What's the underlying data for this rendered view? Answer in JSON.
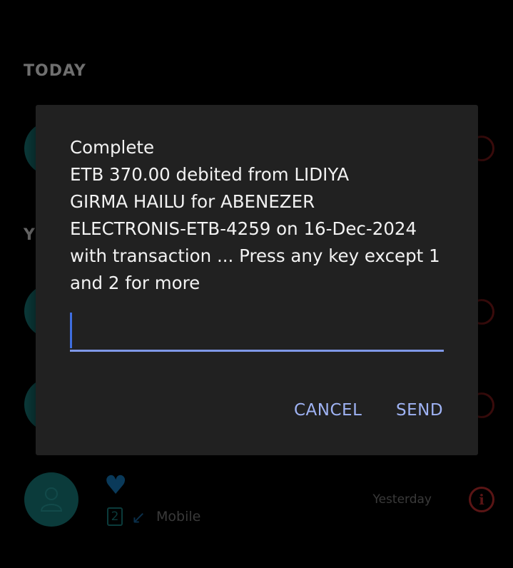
{
  "background": {
    "section_today": "TODAY",
    "section_yesterday": "YE",
    "last_entry": {
      "sim_slot": "2",
      "type": "Mobile",
      "time": "Yesterday"
    }
  },
  "dialog": {
    "message": "Complete\nETB 370.00 debited from LIDIYA\nGIRMA HAILU for ABENEZER\nELECTRONIS-ETB-4259 on 16-Dec-2024\nwith transaction ... Press any key except 1\nand 2 for more",
    "input_value": "",
    "cancel_label": "CANCEL",
    "send_label": "SEND"
  },
  "colors": {
    "dialog_bg": "#212121",
    "accent": "#9fb3f4",
    "caret": "#3f6ee0"
  }
}
